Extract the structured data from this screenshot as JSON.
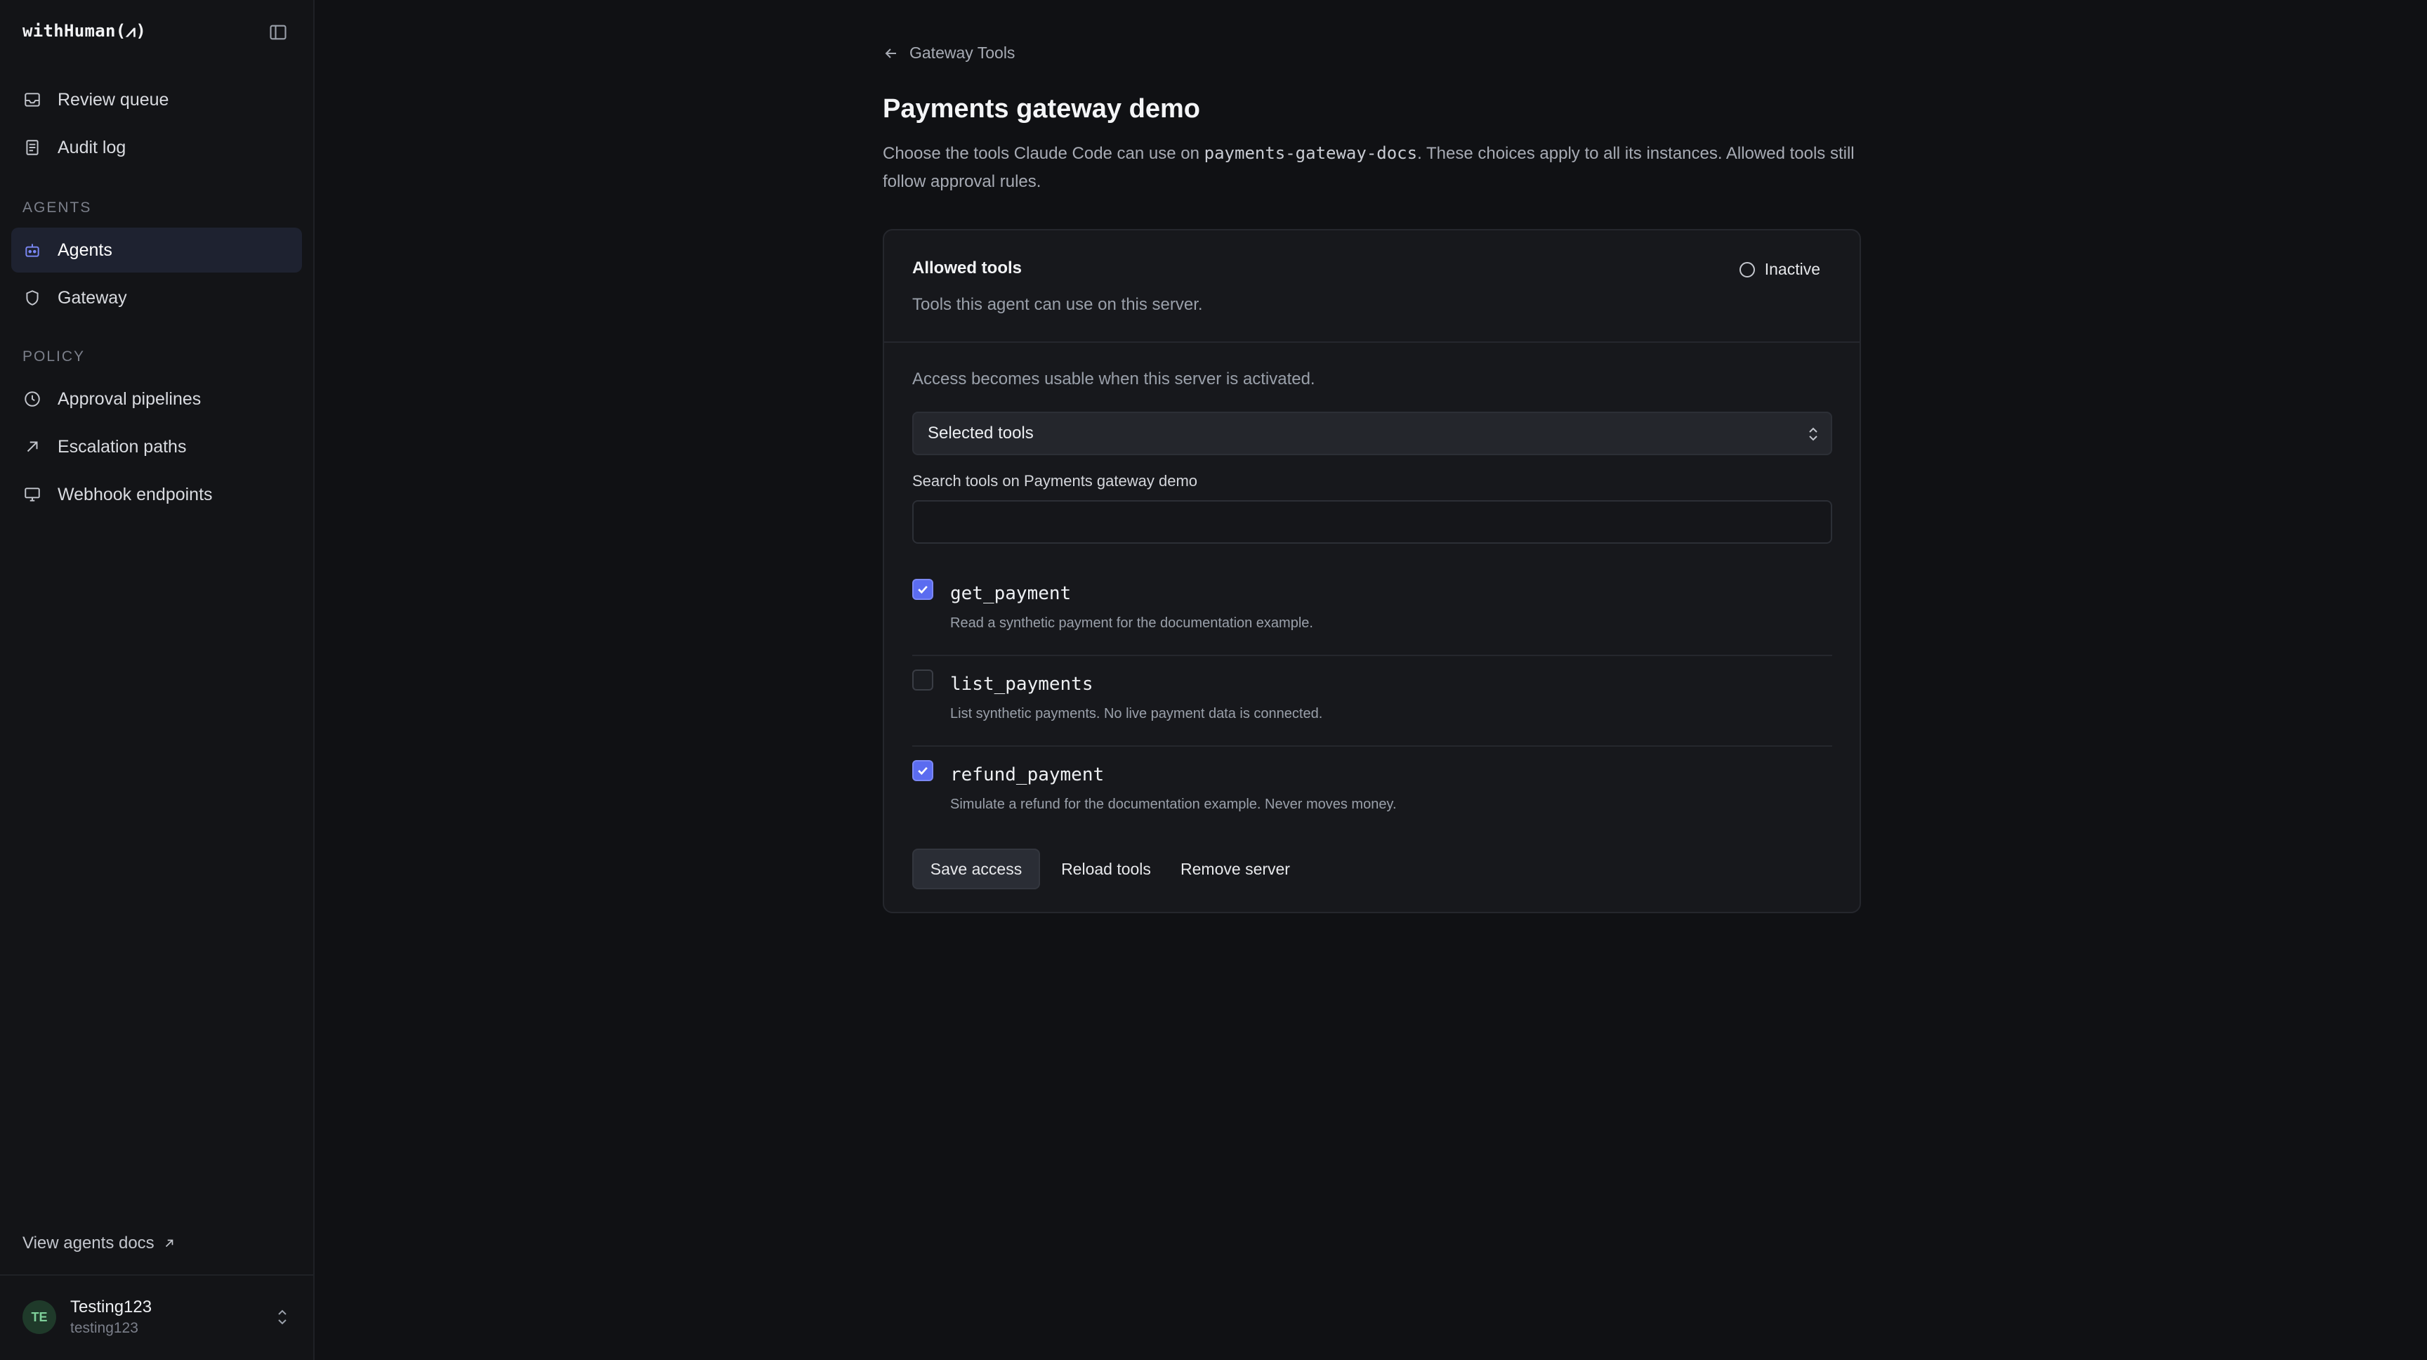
{
  "app": {
    "brand": "withHuman(⩘)"
  },
  "sidebar": {
    "top_items": [
      {
        "label": "Review queue",
        "icon": "inbox-icon"
      },
      {
        "label": "Audit log",
        "icon": "document-icon"
      }
    ],
    "sections": [
      {
        "title": "AGENTS",
        "items": [
          {
            "label": "Agents",
            "icon": "bot-icon",
            "active": true
          },
          {
            "label": "Gateway",
            "icon": "shield-icon"
          }
        ]
      },
      {
        "title": "POLICY",
        "items": [
          {
            "label": "Approval pipelines",
            "icon": "clock-icon"
          },
          {
            "label": "Escalation paths",
            "icon": "arrow-up-right-icon"
          },
          {
            "label": "Webhook endpoints",
            "icon": "monitor-icon"
          }
        ]
      }
    ],
    "docs_link": "View agents docs",
    "user": {
      "initials": "TE",
      "name": "Testing123",
      "handle": "testing123"
    }
  },
  "main": {
    "breadcrumb": "Gateway Tools",
    "title": "Payments gateway demo",
    "description": {
      "before": "Choose the tools Claude Code can use on ",
      "code": "payments-gateway-docs",
      "after": ". These choices apply to all its instances. Allowed tools still follow approval rules."
    },
    "card": {
      "title": "Allowed tools",
      "subtitle": "Tools this agent can use on this server.",
      "status": "Inactive",
      "access_note": "Access becomes usable when this server is activated.",
      "select_value": "Selected tools",
      "search_label": "Search tools on Payments gateway demo",
      "search_value": "",
      "search_placeholder": "",
      "tools": [
        {
          "name": "get_payment",
          "description": "Read a synthetic payment for the documentation example.",
          "checked": true
        },
        {
          "name": "list_payments",
          "description": "List synthetic payments. No live payment data is connected.",
          "checked": false
        },
        {
          "name": "refund_payment",
          "description": "Simulate a refund for the documentation example. Never moves money.",
          "checked": true
        }
      ],
      "buttons": {
        "save": "Save access",
        "reload": "Reload tools",
        "remove": "Remove server"
      }
    }
  },
  "colors": {
    "accent": "#5b6cf0",
    "background": "#101114",
    "sidebar": "#131417",
    "active_nav": "#1e2230"
  }
}
